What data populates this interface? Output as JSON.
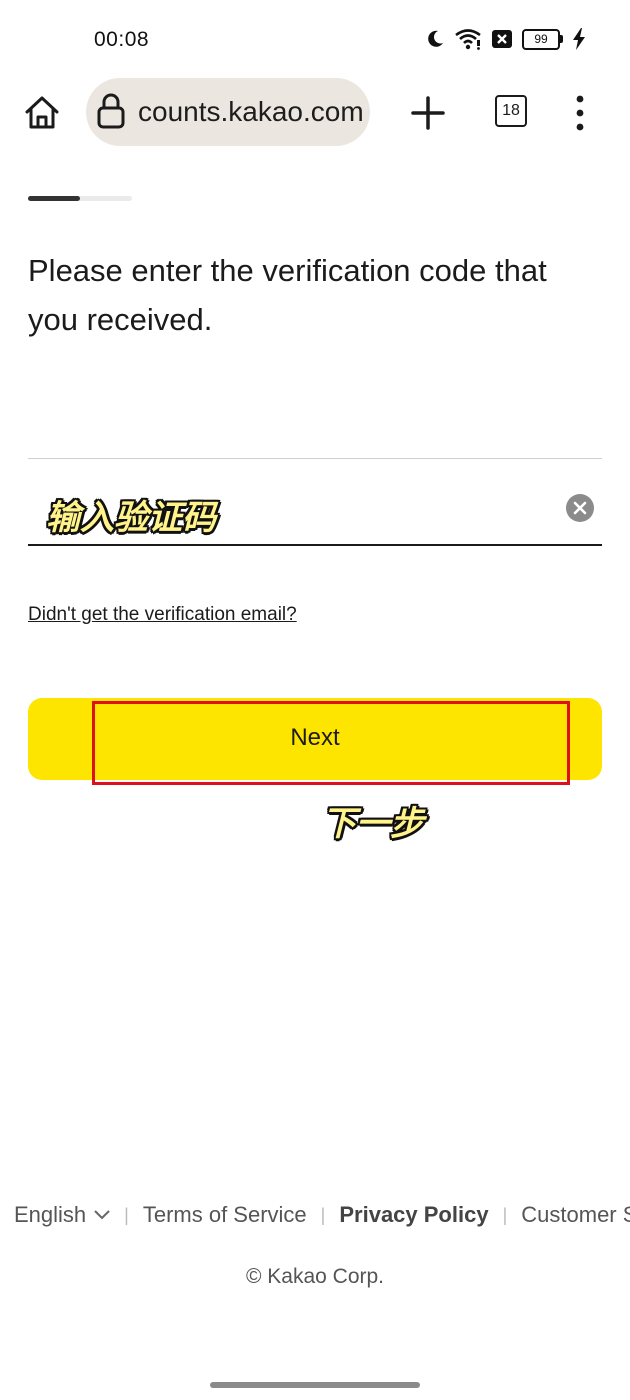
{
  "status_bar": {
    "time": "00:08",
    "battery_level": "99",
    "icons": [
      "moon-icon",
      "wifi-icon",
      "notification-x-icon",
      "battery-icon",
      "charging-bolt-icon"
    ]
  },
  "browser": {
    "url": "accounts.kakao.com",
    "url_visible": "counts.kakao.com",
    "tab_count": "18",
    "icons": [
      "home-icon",
      "lock-icon",
      "plus-icon",
      "tabs-icon",
      "more-vert-icon"
    ]
  },
  "page": {
    "progress": 0.5,
    "heading": "Please enter the verification code that you received.",
    "code_input": {
      "value": "",
      "overlay_annotation": "输入验证码"
    },
    "resend_link": "Didn't get the verification email?",
    "next_button": "Next",
    "next_annotation": "下一步"
  },
  "footer": {
    "language": "English",
    "links": [
      "Terms of Service",
      "Privacy Policy",
      "Customer Se"
    ],
    "copyright": "© Kakao Corp."
  },
  "colors": {
    "accent_yellow": "#fee500",
    "highlight_red": "#e0101a",
    "url_bar_bg": "#ece6e0"
  }
}
